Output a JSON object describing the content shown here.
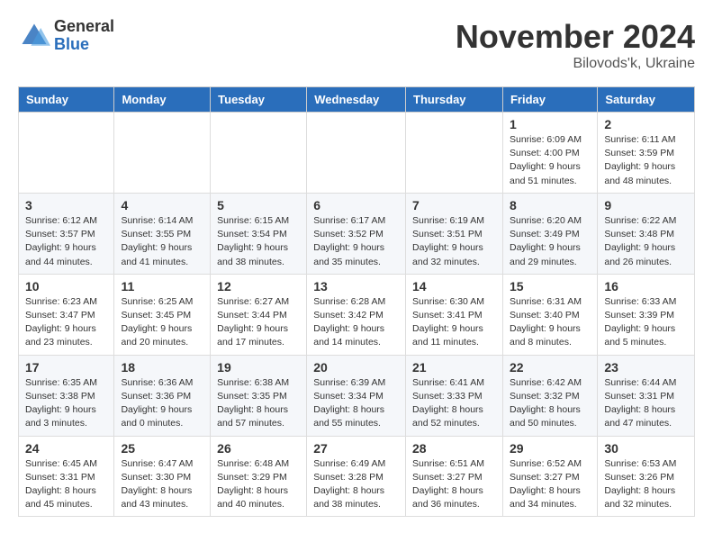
{
  "logo": {
    "general": "General",
    "blue": "Blue"
  },
  "title": "November 2024",
  "location": "Bilovods'k, Ukraine",
  "days_of_week": [
    "Sunday",
    "Monday",
    "Tuesday",
    "Wednesday",
    "Thursday",
    "Friday",
    "Saturday"
  ],
  "weeks": [
    {
      "cells": [
        {
          "day": "",
          "info": ""
        },
        {
          "day": "",
          "info": ""
        },
        {
          "day": "",
          "info": ""
        },
        {
          "day": "",
          "info": ""
        },
        {
          "day": "",
          "info": ""
        },
        {
          "day": "1",
          "info": "Sunrise: 6:09 AM\nSunset: 4:00 PM\nDaylight: 9 hours and 51 minutes."
        },
        {
          "day": "2",
          "info": "Sunrise: 6:11 AM\nSunset: 3:59 PM\nDaylight: 9 hours and 48 minutes."
        }
      ]
    },
    {
      "cells": [
        {
          "day": "3",
          "info": "Sunrise: 6:12 AM\nSunset: 3:57 PM\nDaylight: 9 hours and 44 minutes."
        },
        {
          "day": "4",
          "info": "Sunrise: 6:14 AM\nSunset: 3:55 PM\nDaylight: 9 hours and 41 minutes."
        },
        {
          "day": "5",
          "info": "Sunrise: 6:15 AM\nSunset: 3:54 PM\nDaylight: 9 hours and 38 minutes."
        },
        {
          "day": "6",
          "info": "Sunrise: 6:17 AM\nSunset: 3:52 PM\nDaylight: 9 hours and 35 minutes."
        },
        {
          "day": "7",
          "info": "Sunrise: 6:19 AM\nSunset: 3:51 PM\nDaylight: 9 hours and 32 minutes."
        },
        {
          "day": "8",
          "info": "Sunrise: 6:20 AM\nSunset: 3:49 PM\nDaylight: 9 hours and 29 minutes."
        },
        {
          "day": "9",
          "info": "Sunrise: 6:22 AM\nSunset: 3:48 PM\nDaylight: 9 hours and 26 minutes."
        }
      ]
    },
    {
      "cells": [
        {
          "day": "10",
          "info": "Sunrise: 6:23 AM\nSunset: 3:47 PM\nDaylight: 9 hours and 23 minutes."
        },
        {
          "day": "11",
          "info": "Sunrise: 6:25 AM\nSunset: 3:45 PM\nDaylight: 9 hours and 20 minutes."
        },
        {
          "day": "12",
          "info": "Sunrise: 6:27 AM\nSunset: 3:44 PM\nDaylight: 9 hours and 17 minutes."
        },
        {
          "day": "13",
          "info": "Sunrise: 6:28 AM\nSunset: 3:42 PM\nDaylight: 9 hours and 14 minutes."
        },
        {
          "day": "14",
          "info": "Sunrise: 6:30 AM\nSunset: 3:41 PM\nDaylight: 9 hours and 11 minutes."
        },
        {
          "day": "15",
          "info": "Sunrise: 6:31 AM\nSunset: 3:40 PM\nDaylight: 9 hours and 8 minutes."
        },
        {
          "day": "16",
          "info": "Sunrise: 6:33 AM\nSunset: 3:39 PM\nDaylight: 9 hours and 5 minutes."
        }
      ]
    },
    {
      "cells": [
        {
          "day": "17",
          "info": "Sunrise: 6:35 AM\nSunset: 3:38 PM\nDaylight: 9 hours and 3 minutes."
        },
        {
          "day": "18",
          "info": "Sunrise: 6:36 AM\nSunset: 3:36 PM\nDaylight: 9 hours and 0 minutes."
        },
        {
          "day": "19",
          "info": "Sunrise: 6:38 AM\nSunset: 3:35 PM\nDaylight: 8 hours and 57 minutes."
        },
        {
          "day": "20",
          "info": "Sunrise: 6:39 AM\nSunset: 3:34 PM\nDaylight: 8 hours and 55 minutes."
        },
        {
          "day": "21",
          "info": "Sunrise: 6:41 AM\nSunset: 3:33 PM\nDaylight: 8 hours and 52 minutes."
        },
        {
          "day": "22",
          "info": "Sunrise: 6:42 AM\nSunset: 3:32 PM\nDaylight: 8 hours and 50 minutes."
        },
        {
          "day": "23",
          "info": "Sunrise: 6:44 AM\nSunset: 3:31 PM\nDaylight: 8 hours and 47 minutes."
        }
      ]
    },
    {
      "cells": [
        {
          "day": "24",
          "info": "Sunrise: 6:45 AM\nSunset: 3:31 PM\nDaylight: 8 hours and 45 minutes."
        },
        {
          "day": "25",
          "info": "Sunrise: 6:47 AM\nSunset: 3:30 PM\nDaylight: 8 hours and 43 minutes."
        },
        {
          "day": "26",
          "info": "Sunrise: 6:48 AM\nSunset: 3:29 PM\nDaylight: 8 hours and 40 minutes."
        },
        {
          "day": "27",
          "info": "Sunrise: 6:49 AM\nSunset: 3:28 PM\nDaylight: 8 hours and 38 minutes."
        },
        {
          "day": "28",
          "info": "Sunrise: 6:51 AM\nSunset: 3:27 PM\nDaylight: 8 hours and 36 minutes."
        },
        {
          "day": "29",
          "info": "Sunrise: 6:52 AM\nSunset: 3:27 PM\nDaylight: 8 hours and 34 minutes."
        },
        {
          "day": "30",
          "info": "Sunrise: 6:53 AM\nSunset: 3:26 PM\nDaylight: 8 hours and 32 minutes."
        }
      ]
    }
  ]
}
